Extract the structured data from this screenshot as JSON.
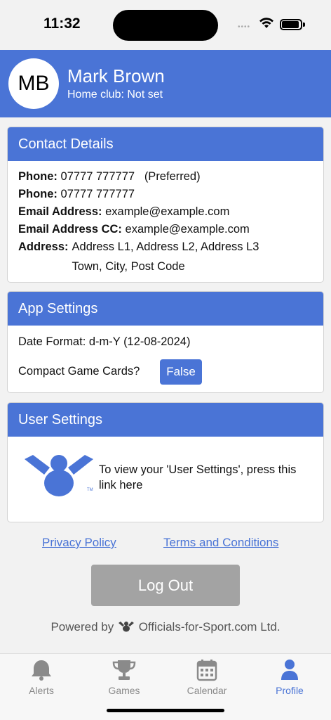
{
  "status_bar": {
    "time": "11:32",
    "signal": "••••"
  },
  "profile": {
    "initials": "MB",
    "name": "Mark Brown",
    "home_club": "Home club: Not set"
  },
  "contact": {
    "title": "Contact Details",
    "phone1_label": "Phone:",
    "phone1_value": "07777 777777",
    "phone1_note": "(Preferred)",
    "phone2_label": "Phone:",
    "phone2_value": "07777 777777",
    "email_label": "Email Address:",
    "email_value": "example@example.com",
    "email_cc_label": "Email Address CC:",
    "email_cc_value": "example@example.com",
    "address_label": "Address:",
    "address_line1": "Address L1, Address L2, Address L3",
    "address_line2": "Town, City, Post Code"
  },
  "app_settings": {
    "title": "App Settings",
    "date_format": "Date Format: d-m-Y (12-08-2024)",
    "compact_label": "Compact Game Cards?",
    "compact_value": "False"
  },
  "user_settings": {
    "title": "User Settings",
    "text": "To view your 'User Settings', press this link here"
  },
  "links": {
    "privacy": "Privacy Policy",
    "terms": "Terms and Conditions"
  },
  "logout_label": "Log Out",
  "powered": {
    "prefix": "Powered by",
    "company": "Officials-for-Sport.com Ltd."
  },
  "tabs": [
    {
      "label": "Alerts",
      "icon": "bell-icon",
      "active": false
    },
    {
      "label": "Games",
      "icon": "trophy-icon",
      "active": false
    },
    {
      "label": "Calendar",
      "icon": "calendar-icon",
      "active": false
    },
    {
      "label": "Profile",
      "icon": "person-icon",
      "active": true
    }
  ],
  "colors": {
    "accent": "#4a74d6",
    "disabled": "#a3a3a3",
    "background": "#f2f2f2"
  }
}
